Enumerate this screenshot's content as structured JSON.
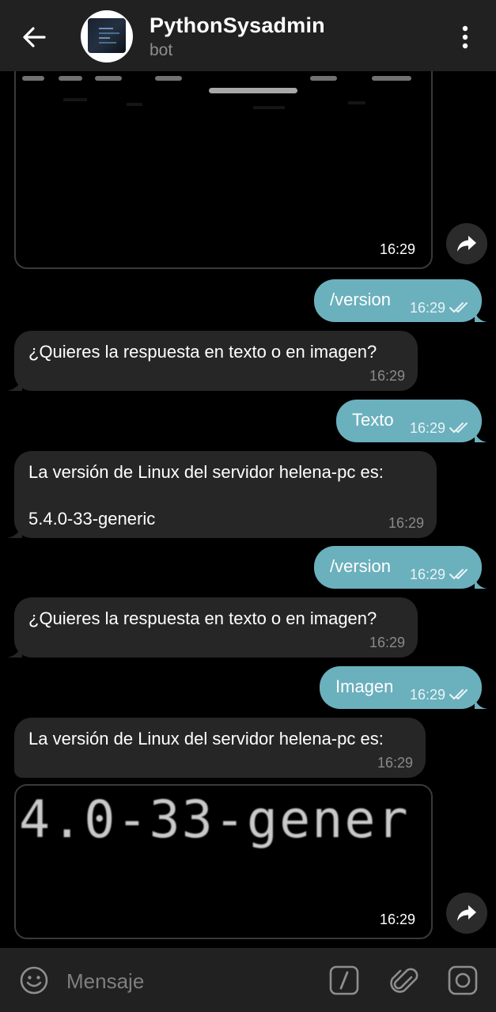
{
  "header": {
    "title": "PythonSysadmin",
    "subtitle": "bot"
  },
  "messages": {
    "img1_time": "16:29",
    "m1_text": "/version",
    "m1_time": "16:29",
    "m2_text": "¿Quieres la respuesta en texto o en imagen?",
    "m2_time": "16:29",
    "m3_text": "Texto",
    "m3_time": "16:29",
    "m4_line1": "La versión de Linux del servidor helena-pc es:",
    "m4_line2": "5.4.0-33-generic",
    "m4_time": "16:29",
    "m5_text": "/version",
    "m5_time": "16:29",
    "m6_text": "¿Quieres la respuesta en texto o en imagen?",
    "m6_time": "16:29",
    "m7_text": "Imagen",
    "m7_time": "16:29",
    "m8_text": "La versión de Linux del servidor helena-pc es:",
    "m8_time": "16:29",
    "img2_text": "4.0-33-gener",
    "img2_time": "16:29"
  },
  "input": {
    "placeholder": "Mensaje"
  },
  "colors": {
    "header_bg": "#212121",
    "outgoing_bubble": "#6bb0bd",
    "incoming_bubble": "#262626",
    "background": "#000000"
  },
  "icons": [
    "back-arrow-icon",
    "kebab-menu-icon",
    "share-icon",
    "double-check-icon",
    "emoji-icon",
    "bot-command-icon",
    "attach-icon",
    "camera-icon"
  ]
}
